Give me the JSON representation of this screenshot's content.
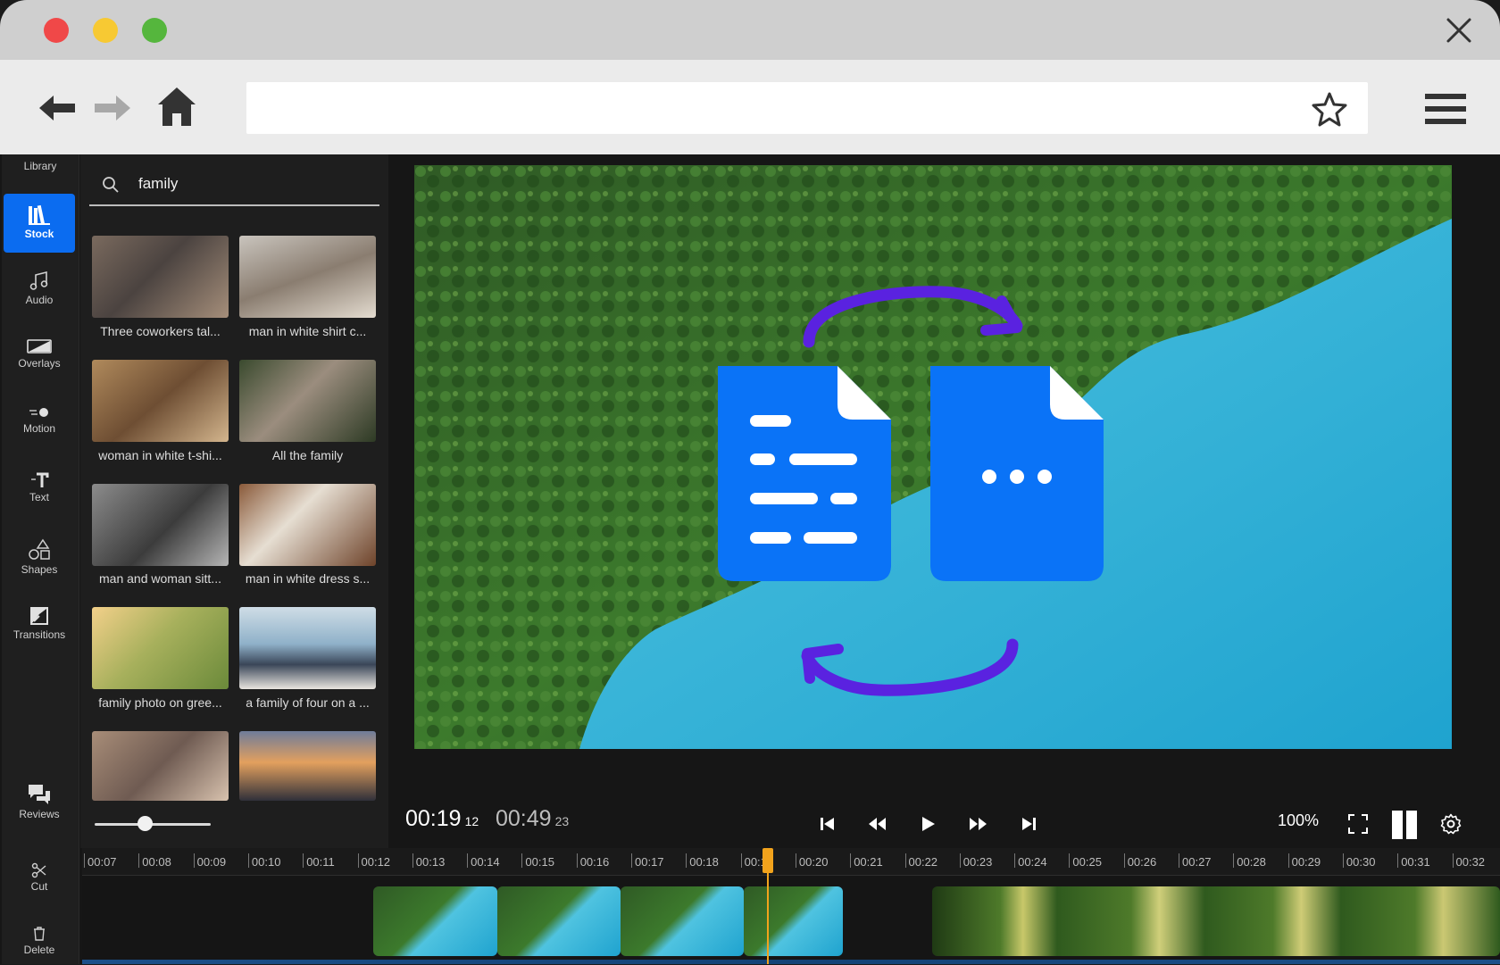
{
  "window": {
    "controls": [
      "close-dot",
      "minimize-dot",
      "zoom-dot"
    ],
    "colors": {
      "red": "#f04848",
      "yellow": "#f7c933",
      "green": "#55b63d"
    }
  },
  "browser": {
    "address": "",
    "icons": [
      "back-arrow-icon",
      "forward-arrow-icon",
      "home-icon",
      "star-icon",
      "hamburger-menu-icon",
      "close-icon"
    ]
  },
  "sidebar": {
    "title": "Library",
    "items": [
      {
        "label": "Stock",
        "icon": "books-icon",
        "active": true
      },
      {
        "label": "Audio",
        "icon": "music-note-icon"
      },
      {
        "label": "Overlays",
        "icon": "overlay-icon"
      },
      {
        "label": "Motion",
        "icon": "motion-icon"
      },
      {
        "label": "Text",
        "icon": "text-icon"
      },
      {
        "label": "Shapes",
        "icon": "shapes-icon"
      },
      {
        "label": "Transitions",
        "icon": "transitions-icon"
      },
      {
        "label": "Reviews",
        "icon": "chat-bubbles-icon"
      }
    ],
    "accent": "#0b6cf0"
  },
  "stock": {
    "search_query": "family",
    "results": [
      {
        "caption": "Three coworkers tal..."
      },
      {
        "caption": "man in white shirt c..."
      },
      {
        "caption": "woman in white t-shi..."
      },
      {
        "caption": "All the family"
      },
      {
        "caption": "man and woman sitt..."
      },
      {
        "caption": "man in white dress s..."
      },
      {
        "caption": "family photo on gree..."
      },
      {
        "caption": "a family of four on a ..."
      },
      {
        "caption": ""
      },
      {
        "caption": ""
      }
    ],
    "thumb_size_level": 0.4
  },
  "player": {
    "current_time": "00:19",
    "current_frame": "12",
    "total_time": "00:49",
    "total_frame": "23",
    "zoom": "100%",
    "controls": [
      "skip-to-start-icon",
      "rewind-icon",
      "play-icon",
      "fast-forward-icon",
      "skip-to-end-icon",
      "fullscreen-icon",
      "split-view-icon",
      "settings-gear-icon"
    ]
  },
  "timeline": {
    "tools": [
      {
        "label": "Cut",
        "icon": "scissors-icon"
      },
      {
        "label": "Delete",
        "icon": "trash-icon"
      }
    ],
    "ticks": [
      "00:07",
      "00:08",
      "00:09",
      "00:10",
      "00:11",
      "00:12",
      "00:13",
      "00:14",
      "00:15",
      "00:16",
      "00:17",
      "00:18",
      "00:19",
      "00:20",
      "00:21",
      "00:22",
      "00:23",
      "00:24",
      "00:25",
      "00:26",
      "00:27",
      "00:28",
      "00:29",
      "00:30",
      "00:31",
      "00:32"
    ],
    "playhead_time": "00:19",
    "playhead_color": "#f2a31c"
  },
  "overlay_graphic": {
    "icons": [
      "document-lines-icon",
      "document-ellipsis-icon",
      "swap-arrow-top-icon",
      "swap-arrow-bottom-icon"
    ],
    "doc_color": "#0a73f7",
    "arrow_color": "#5a22e0"
  }
}
